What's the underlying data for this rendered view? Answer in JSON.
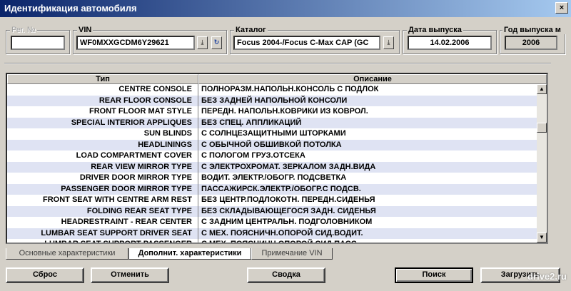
{
  "window": {
    "title": "Идентификация автомобиля",
    "close_label": "×"
  },
  "fields": {
    "reg_no": {
      "label": "Рег. №",
      "value": ""
    },
    "vin": {
      "label": "VIN",
      "value": "WF0MXXGCDM6Y29621",
      "down_icon": "⤓",
      "refresh_icon": "↻"
    },
    "catalog": {
      "label": "Каталог",
      "value": "Focus 2004-/Focus C-Max CAP (GC",
      "down_icon": "⤓"
    },
    "release_date": {
      "label": "Дата выпуска",
      "value": "14.02.2006"
    },
    "release_year": {
      "label": "Год выпуска м",
      "value": "2006"
    }
  },
  "table": {
    "headers": {
      "type": "Тип",
      "description": "Описание"
    },
    "rows": [
      {
        "type": "CENTRE CONSOLE",
        "description": "ПОЛНОРАЗМ.НАПОЛЬН.КОНСОЛЬ С ПОДЛОК"
      },
      {
        "type": "REAR FLOOR CONSOLE",
        "description": "БЕЗ ЗАДНЕЙ НАПОЛЬНОЙ КОНСОЛИ"
      },
      {
        "type": "FRONT FLOOR MAT STYLE",
        "description": "ПЕРЕДН. НАПОЛЬН.КОВРИКИ ИЗ КОВРОЛ."
      },
      {
        "type": "SPECIAL INTERIOR APPLIQUES",
        "description": "БЕЗ СПЕЦ. АППЛИКАЦИЙ"
      },
      {
        "type": "SUN BLINDS",
        "description": "С СОЛНЦЕЗАЩИТНЫМИ ШТОРКАМИ"
      },
      {
        "type": "HEADLININGS",
        "description": "С ОБЫЧНОЙ ОБШИВКОЙ ПОТОЛКА"
      },
      {
        "type": "LOAD COMPARTMENT COVER",
        "description": "С ПОЛОГОМ ГРУЗ.ОТСЕКА"
      },
      {
        "type": "REAR VIEW MIRROR TYPE",
        "description": "С ЭЛЕКТРОХРОМАТ. ЗЕРКАЛОМ ЗАДН.ВИДА"
      },
      {
        "type": "DRIVER DOOR MIRROR TYPE",
        "description": "ВОДИТ. ЭЛЕКТР./ОБОГР. ПОДСВЕТКА"
      },
      {
        "type": "PASSENGER DOOR MIRROR TYPE",
        "description": "ПАССАЖИРСК.ЭЛЕКТР./ОБОГР.С ПОДСВ."
      },
      {
        "type": "FRONT SEAT WITH CENTRE ARM REST",
        "description": "БЕЗ ЦЕНТР.ПОДЛОКОТН. ПЕРЕДН.СИДЕНЬЯ"
      },
      {
        "type": "FOLDING REAR SEAT TYPE",
        "description": "БЕЗ СКЛАДЫВАЮЩЕГОСЯ ЗАДН. СИДЕНЬЯ"
      },
      {
        "type": "HEADRESTRAINT - REAR CENTER",
        "description": "С ЗАДНИМ ЦЕНТРАЛЬН. ПОДГОЛОВНИКОМ"
      },
      {
        "type": "LUMBAR SEAT SUPPORT DRIVER SEAT",
        "description": "С МЕХ. ПОЯСНИЧН.ОПОРОЙ СИД.ВОДИТ."
      },
      {
        "type": "LUMBAR SEAT SUPPORT PASSENGER",
        "description": "С МЕХ. ПОЯСНИЧН.ОПОРОЙ СИД.ПАСС."
      }
    ]
  },
  "scrollbar": {
    "up_icon": "▲",
    "down_icon": "▼"
  },
  "tabs": [
    {
      "label": "Основные характеристики"
    },
    {
      "label": "Дополнит. характеристики"
    },
    {
      "label": "Примечание VIN"
    }
  ],
  "buttons": {
    "reset": "Сброс",
    "cancel": "Отменить",
    "summary": "Сводка",
    "search": "Поиск",
    "load": "Загрузить"
  },
  "watermark": "drive2.ru"
}
